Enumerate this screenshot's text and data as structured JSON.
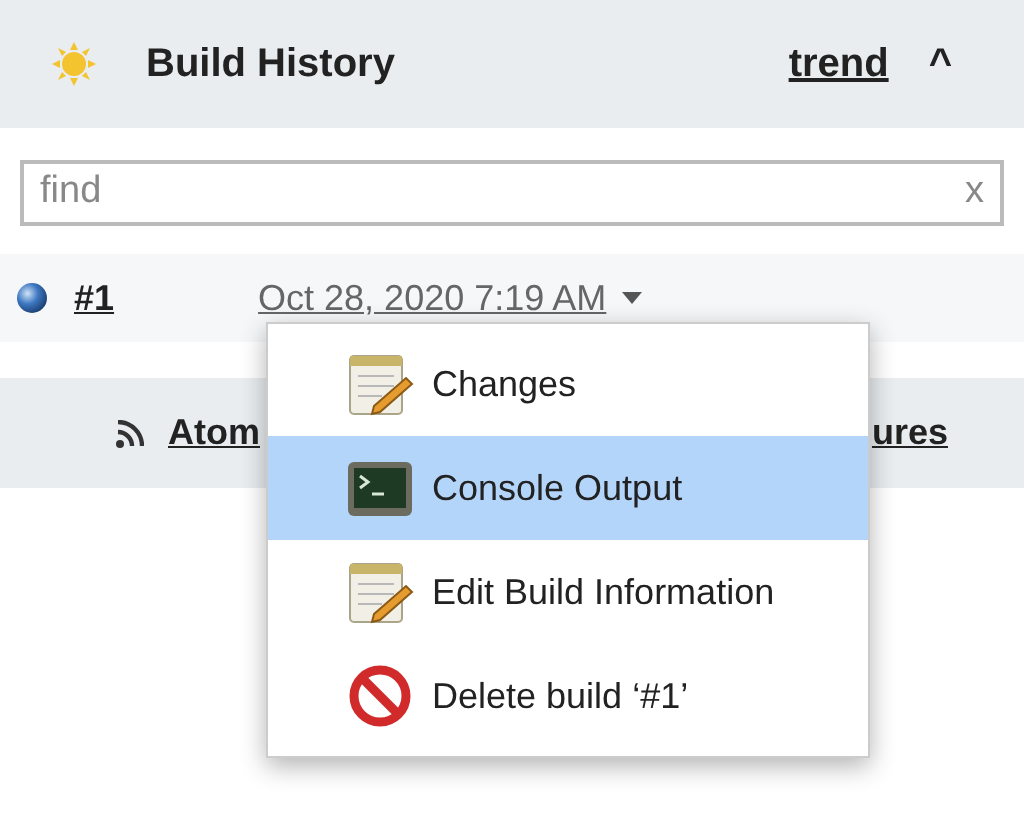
{
  "panel": {
    "title": "Build History",
    "trend_link": "trend",
    "collapse_icon": "^"
  },
  "search": {
    "placeholder": "find",
    "clear": "x"
  },
  "builds": [
    {
      "number": "#1",
      "date": "Oct 28, 2020 7:19 AM"
    }
  ],
  "footer": {
    "links": [
      "Atom",
      "ures"
    ]
  },
  "menu": {
    "items": [
      {
        "kind": "notes",
        "label": "Changes",
        "selected": false
      },
      {
        "kind": "console",
        "label": "Console Output",
        "selected": true
      },
      {
        "kind": "notes",
        "label": "Edit Build Information",
        "selected": false
      },
      {
        "kind": "delete",
        "label": "Delete build ‘#1’",
        "selected": false
      }
    ]
  }
}
